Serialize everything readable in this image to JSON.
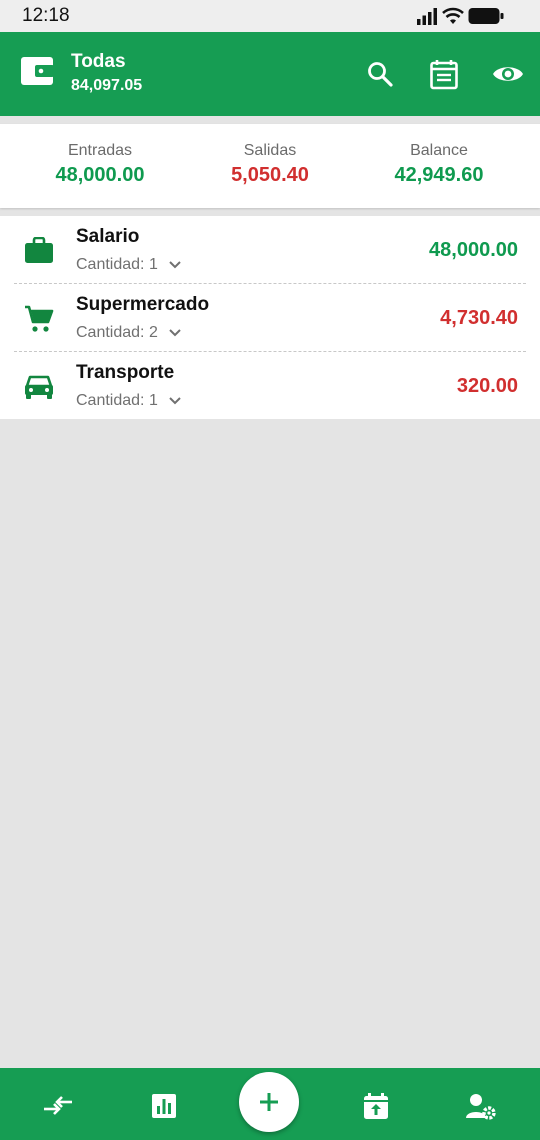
{
  "status_bar": {
    "time": "12:18"
  },
  "header": {
    "account_name": "Todas",
    "account_balance": "84,097.05",
    "actions": [
      "search-icon",
      "calendar-list-icon",
      "eye-icon"
    ]
  },
  "summary": {
    "income_label": "Entradas",
    "income_value": "48,000.00",
    "expense_label": "Salidas",
    "expense_value": "5,050.40",
    "balance_label": "Balance",
    "balance_value": "42,949.60"
  },
  "categories": [
    {
      "name": "Salario",
      "quantity": "Cantidad: 1",
      "amount": "48,000.00",
      "type": "income",
      "icon": "briefcase-icon"
    },
    {
      "name": "Supermercado",
      "quantity": "Cantidad: 2",
      "amount": "4,730.40",
      "type": "expense",
      "icon": "cart-icon"
    },
    {
      "name": "Transporte",
      "quantity": "Cantidad: 1",
      "amount": "320.00",
      "type": "expense",
      "icon": "car-icon"
    }
  ],
  "bottom_nav": [
    "transfer-icon",
    "chart-icon",
    "add-icon",
    "calendar-upload-icon",
    "user-settings-icon"
  ],
  "colors": {
    "primary": "#169d53",
    "income": "#0f9a4f",
    "expense": "#d12f2f",
    "background": "#e4e4e4"
  }
}
